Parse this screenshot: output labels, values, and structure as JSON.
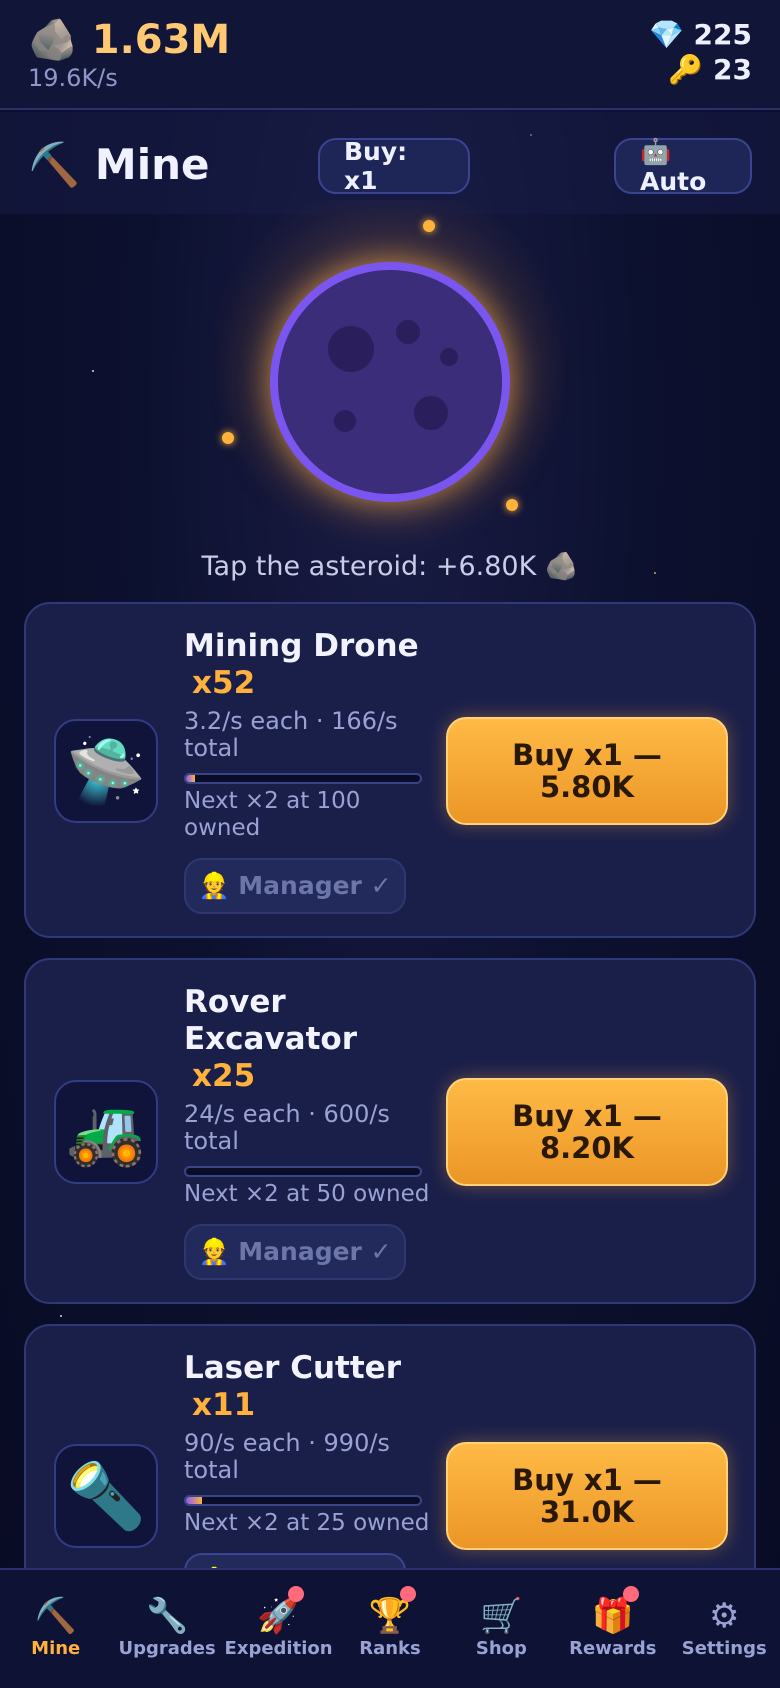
{
  "header": {
    "balance": "🪨 1.63M",
    "rate": "19.6K/s",
    "gems": "💎 225",
    "keys": "🔑 23"
  },
  "section": {
    "title": "⛏️ Mine",
    "buy_multiplier": "Buy: x1",
    "auto_label": "🤖 Auto"
  },
  "tap_hint": "Tap the asteroid: +6.80K 🪨",
  "generators": [
    {
      "icon": "🛸",
      "icon_name": "drone-icon",
      "name": "Mining Drone",
      "count": "x52",
      "rates": "3.2/s each · 166/s total",
      "progress": 0.04,
      "next": "Next ×2 at 100 owned",
      "manager": "👷 Manager ✓",
      "buy": "Buy x1 — 5.80K"
    },
    {
      "icon": "🚜",
      "icon_name": "rover-icon",
      "name": "Rover Excavator",
      "count": "x25",
      "rates": "24/s each · 600/s total",
      "progress": 0.0,
      "next": "Next ×2 at 50 owned",
      "manager": "👷 Manager ✓",
      "buy": "Buy x1 — 8.20K"
    },
    {
      "icon": "🔦",
      "icon_name": "laser-icon",
      "name": "Laser Cutter",
      "count": "x11",
      "rates": "90/s each · 990/s total",
      "progress": 0.07,
      "next": "Next ×2 at 25 owned",
      "manager": "👷 Manager ✓",
      "buy": "Buy x1 — 31.0K"
    }
  ],
  "nav": [
    {
      "icon": "⛏️",
      "label": "Mine",
      "active": true,
      "badge": false
    },
    {
      "icon": "🔧",
      "label": "Upgrades",
      "active": false,
      "badge": false
    },
    {
      "icon": "🚀",
      "label": "Expedition",
      "active": false,
      "badge": true
    },
    {
      "icon": "🏆",
      "label": "Ranks",
      "active": false,
      "badge": true
    },
    {
      "icon": "🛒",
      "label": "Shop",
      "active": false,
      "badge": false
    },
    {
      "icon": "🎁",
      "label": "Rewards",
      "active": false,
      "badge": true
    },
    {
      "icon": "⚙",
      "label": "Settings",
      "active": false,
      "badge": false
    }
  ],
  "colors": {
    "accent": "#ffb13c",
    "asteroid_ring": "#7b55f0",
    "badge": "#ff6b7a"
  }
}
